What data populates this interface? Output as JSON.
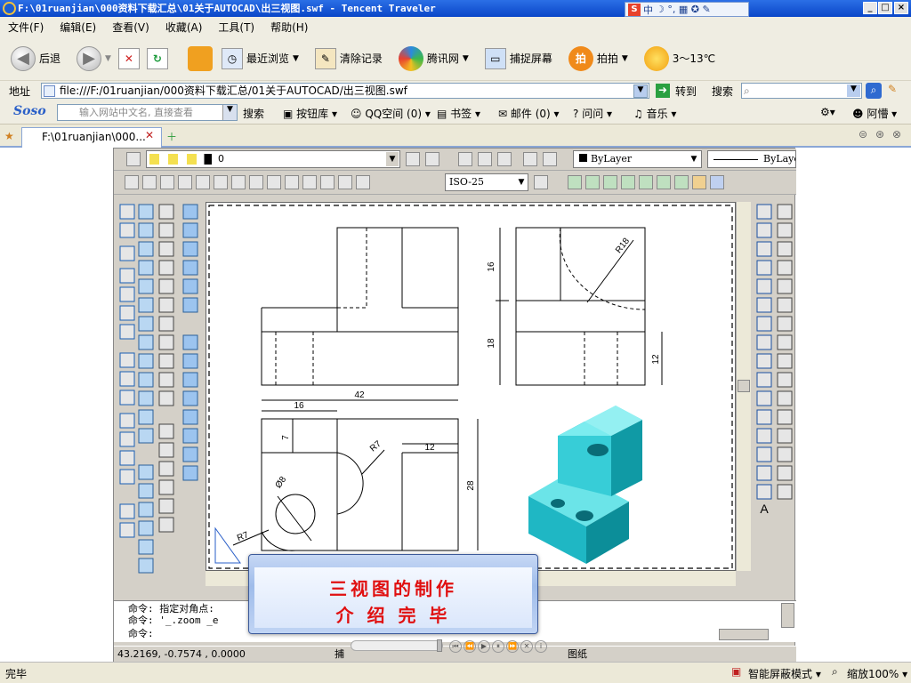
{
  "window": {
    "title": "F:\\01ruanjian\\000资料下载汇总\\01关于AUTOCAD\\出三视图.swf - Tencent Traveler",
    "min": "_",
    "max": "□",
    "close": "×"
  },
  "ime": {
    "s": "S",
    "zh": "中",
    "icons": "☽ °, ▦ ✪ ✎"
  },
  "menu": [
    "文件(F)",
    "编辑(E)",
    "查看(V)",
    "收藏(A)",
    "工具(T)",
    "帮助(H)"
  ],
  "nav": {
    "back": "后退",
    "recent": "最近浏览",
    "clear": "清除记录",
    "qq": "腾讯网",
    "capture": "捕捉屏幕",
    "paipai": "拍拍",
    "weather": "3～13℃"
  },
  "address": {
    "label": "地址",
    "url": "file:///F:/01ruanjian/000资料下载汇总/01关于AUTOCAD/出三视图.swf",
    "go": "转到",
    "search": "搜索"
  },
  "soso": {
    "logo": "Soso",
    "placeholder": "输入网站中文名, 直接查看",
    "search": "搜索",
    "buttons": "按钮库",
    "qzone": "QQ空间 (0)",
    "bookmark": "书签",
    "mail": "邮件 (0)",
    "ask": "问问",
    "music": "音乐",
    "user": "阿懵"
  },
  "tab": {
    "label": "F:\\01ruanjian\\000..."
  },
  "cad": {
    "layer": "0",
    "color": "ByLayer",
    "linetype": "ByLaye",
    "dimstyle": "ISO-25",
    "dims": {
      "d16a": "16",
      "d18": "18",
      "r18": "R18",
      "d12a": "12",
      "d42": "42",
      "d16b": "16",
      "d7": "7",
      "r7a": "R7",
      "d12b": "12",
      "d28": "28",
      "phi8": "Ø8",
      "r7b": "R7"
    },
    "cmd_lines": [
      "命令: 指定对角点:",
      "命令: '_.zoom _e",
      "命令:"
    ],
    "coords": "43.2169, -0.7574 , 0.0000",
    "snap": "捕",
    "paper": "图纸"
  },
  "overlay": {
    "line1": "三视图的制作",
    "line2": "介 绍 完 毕"
  },
  "status": {
    "done": "完毕",
    "mode": "智能屏蔽模式",
    "zoom": "缩放100%"
  }
}
